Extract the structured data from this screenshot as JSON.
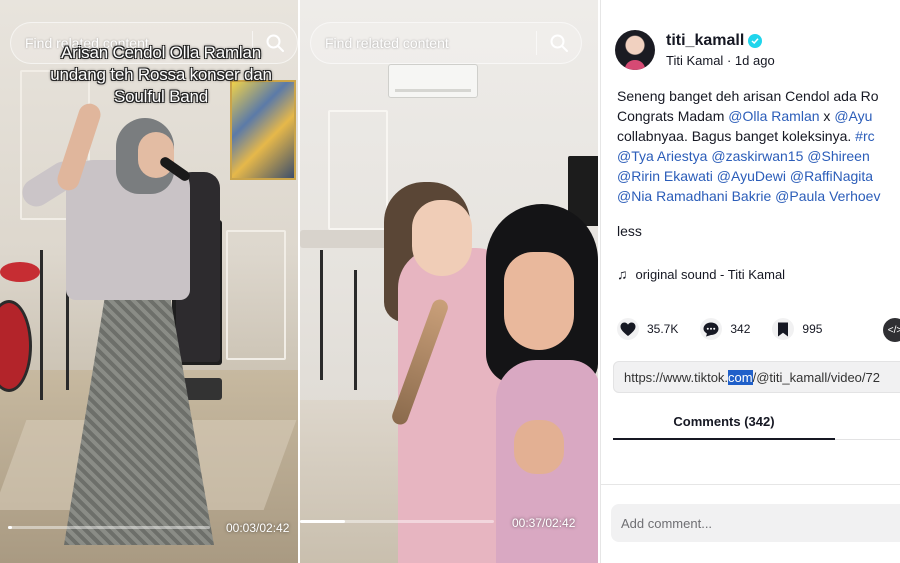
{
  "video_left": {
    "search_placeholder": "Find related content",
    "caption_lines": [
      "Arisan Cendol Olla Ramlan",
      "undang teh Rossa konser dan",
      "Soulful Band"
    ],
    "timecode": "00:03/02:42",
    "progress_fraction": 0.02
  },
  "video_middle": {
    "search_placeholder": "Find related content",
    "timecode": "00:37/02:42",
    "progress_fraction": 0.23
  },
  "post": {
    "username": "titi_kamall",
    "display_name": "Titi Kamal",
    "separator": "·",
    "time_ago": "1d ago",
    "description": {
      "line1": "Seneng banget deh arisan Cendol ada Ro",
      "line2_prefix": "Congrats Madam ",
      "line2_tag1": "@Olla Ramlan",
      "line2_mid": " x ",
      "line2_tag2": "@Ayu",
      "line3_text": "collabnyaa. Bagus banget koleksinya. ",
      "line3_tag": "#rc",
      "line4": "@Tya Ariestya @zaskirwan15 @Shireen",
      "line5": "@Ririn Ekawati @AyuDewi @RaffiNagita",
      "line6": "@Nia Ramadhani Bakrie @Paula Verhoev"
    },
    "less_label": "less",
    "sound": "original sound - Titi Kamal",
    "likes": "35.7K",
    "comments_count": "342",
    "saves": "995",
    "url": {
      "before": "https://www.tiktok.",
      "selected": "com",
      "after": "/@titi_kamall/video/72"
    },
    "comments_tab": "Comments (342)",
    "add_comment_placeholder": "Add comment..."
  },
  "colors": {
    "mention": "#2b5db9",
    "verified": "#20d5ec",
    "selection": "#1f5fc9"
  },
  "icons": [
    "search-icon",
    "verified-icon",
    "music-note-icon",
    "heart-icon",
    "comment-icon",
    "bookmark-icon",
    "embed-icon"
  ]
}
